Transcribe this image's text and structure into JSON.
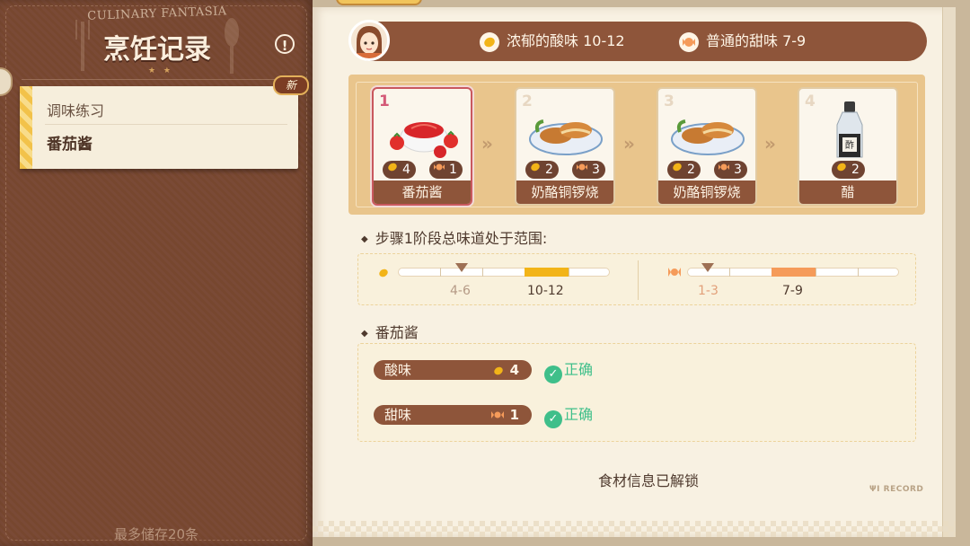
{
  "left": {
    "subtitle": "CULINARY FANTASIA",
    "title": "烹饪记录",
    "stars": "★ ★",
    "info_icon": "!",
    "new_badge": "新",
    "records": [
      "调味练习",
      "番茄酱"
    ],
    "storage_note": "最多储存20条"
  },
  "header": {
    "sour_requirement": "浓郁的酸味 10-12",
    "sweet_requirement": "普通的甜味 7-9"
  },
  "steps": [
    {
      "number": "1",
      "name": "番茄酱",
      "sour": "4",
      "sweet": "1"
    },
    {
      "number": "2",
      "name": "奶酪铜锣烧",
      "sour": "2",
      "sweet": "3"
    },
    {
      "number": "3",
      "name": "奶酪铜锣烧",
      "sour": "2",
      "sweet": "3"
    },
    {
      "number": "4",
      "name": "醋",
      "sour": "2"
    }
  ],
  "arrows": "»",
  "range_section": {
    "heading": "步骤1阶段总味道处于范围:",
    "sour_current": "4-6",
    "sour_target": "10-12",
    "sweet_current": "1-3",
    "sweet_target": "7-9"
  },
  "ingredient": {
    "heading": "番茄酱",
    "rows": [
      {
        "label": "酸味",
        "value": "4",
        "result": "正确"
      },
      {
        "label": "甜味",
        "value": "1",
        "result": "正确"
      }
    ]
  },
  "unlock_note": "食材信息已解锁",
  "record_mark": "RECORD",
  "colors": {
    "brown_cover": "#7a4a36",
    "header_brown": "#8e553a",
    "sour_orange": "#f2b418",
    "sweet_orange": "#f59b5a",
    "correct_green": "#3fbf8a",
    "active_border": "#c9585e"
  }
}
